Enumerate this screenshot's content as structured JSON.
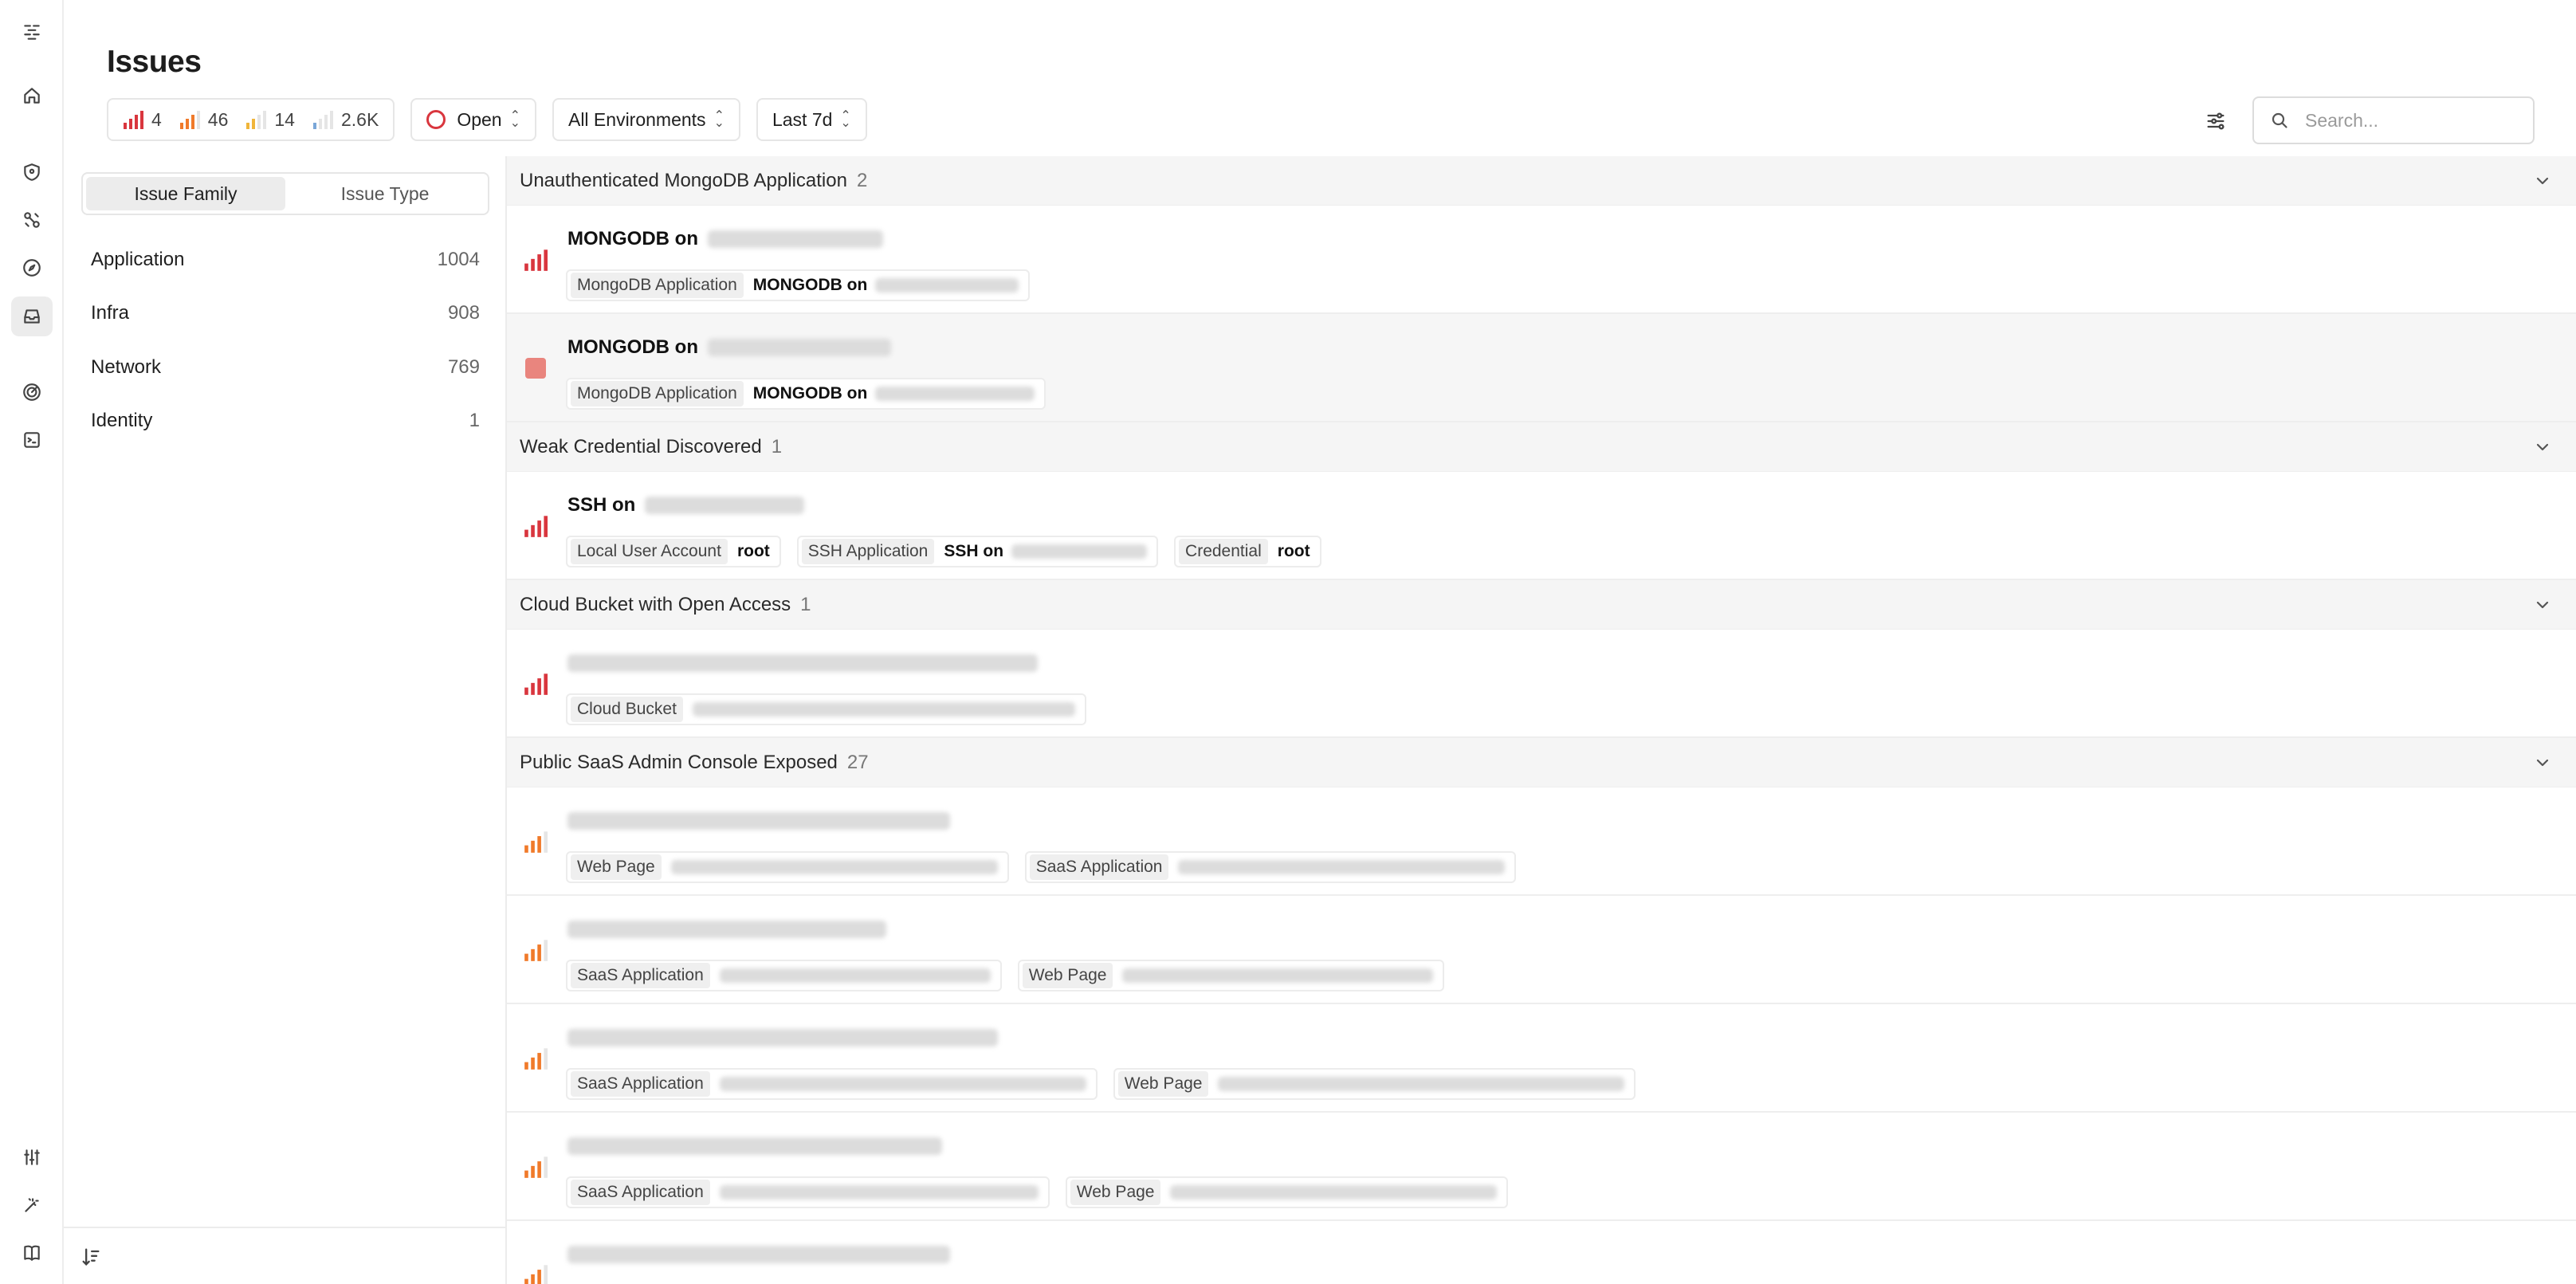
{
  "page": {
    "title": "Issues"
  },
  "severity_counts": [
    {
      "level": "critical",
      "count": "4",
      "color": "#d9363e"
    },
    {
      "level": "high",
      "count": "46",
      "color": "#f07a2a"
    },
    {
      "level": "medium",
      "count": "14",
      "color": "#f0b53a"
    },
    {
      "level": "low",
      "count": "2.6K",
      "color": "#7aa7d8"
    }
  ],
  "filters": {
    "status": "Open",
    "environment": "All Environments",
    "time_range": "Last 7d"
  },
  "search": {
    "placeholder": "Search..."
  },
  "left_panel": {
    "tabs": [
      {
        "label": "Issue Family",
        "active": true
      },
      {
        "label": "Issue Type",
        "active": false
      }
    ],
    "families": [
      {
        "name": "Application",
        "count": "1004"
      },
      {
        "name": "Infra",
        "count": "908"
      },
      {
        "name": "Network",
        "count": "769"
      },
      {
        "name": "Identity",
        "count": "1"
      }
    ]
  },
  "groups": [
    {
      "title": "Unauthenticated MongoDB Application",
      "count": "2",
      "issues": [
        {
          "severity": "critical",
          "title": "MONGODB on",
          "tags": [
            {
              "key": "MongoDB Application",
              "value": "MONGODB on"
            }
          ]
        },
        {
          "severity": "stopped",
          "title": "MONGODB on",
          "tags": [
            {
              "key": "MongoDB Application",
              "value": "MONGODB on"
            }
          ]
        }
      ]
    },
    {
      "title": "Weak Credential Discovered",
      "count": "1",
      "issues": [
        {
          "severity": "critical",
          "title": "SSH on",
          "tags": [
            {
              "key": "Local User Account",
              "value": "root"
            },
            {
              "key": "SSH Application",
              "value": "SSH on"
            },
            {
              "key": "Credential",
              "value": "root"
            }
          ]
        }
      ]
    },
    {
      "title": "Cloud Bucket with Open Access",
      "count": "1",
      "issues": [
        {
          "severity": "critical",
          "title": "",
          "tags": [
            {
              "key": "Cloud Bucket",
              "value": ""
            }
          ]
        }
      ]
    },
    {
      "title": "Public SaaS Admin Console Exposed",
      "count": "27",
      "issues": [
        {
          "severity": "high",
          "title": "",
          "tags": [
            {
              "key": "Web Page",
              "value": ""
            },
            {
              "key": "SaaS Application",
              "value": ""
            }
          ]
        },
        {
          "severity": "high",
          "title": "",
          "tags": [
            {
              "key": "SaaS Application",
              "value": ""
            },
            {
              "key": "Web Page",
              "value": ""
            }
          ]
        },
        {
          "severity": "high",
          "title": "",
          "tags": [
            {
              "key": "SaaS Application",
              "value": ""
            },
            {
              "key": "Web Page",
              "value": ""
            }
          ]
        },
        {
          "severity": "high",
          "title": "",
          "tags": [
            {
              "key": "SaaS Application",
              "value": ""
            },
            {
              "key": "Web Page",
              "value": ""
            }
          ]
        },
        {
          "severity": "high",
          "title": "",
          "tags": []
        }
      ]
    }
  ]
}
